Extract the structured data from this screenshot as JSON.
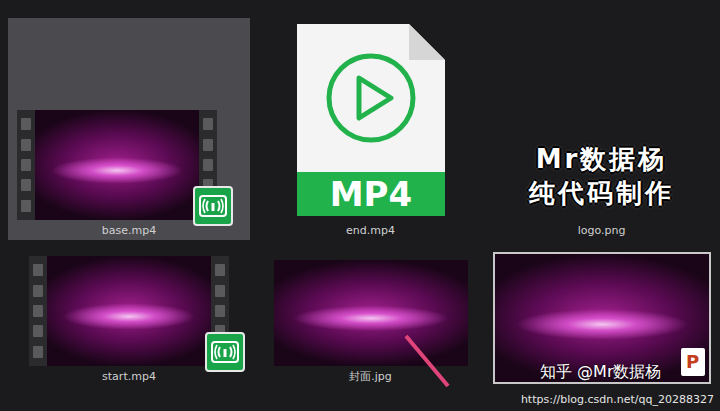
{
  "files": [
    {
      "name": "base.mp4",
      "kind": "video",
      "selected": true
    },
    {
      "name": "end.mp4",
      "kind": "file-icon",
      "selected": false,
      "icon_label": "MP4"
    },
    {
      "name": "logo.png",
      "kind": "logo",
      "selected": false,
      "lines": [
        "Mr数据杨",
        "纯代码制作"
      ]
    },
    {
      "name": "start.mp4",
      "kind": "video",
      "selected": false
    },
    {
      "name": "封面.jpg",
      "kind": "image",
      "selected": false
    },
    {
      "name": "",
      "kind": "slides",
      "selected": false,
      "icon_label": "P"
    }
  ],
  "watermark": {
    "zhihu": "知乎 @Mr数据杨",
    "url": "https://blog.csdn.net/qq_20288327"
  }
}
